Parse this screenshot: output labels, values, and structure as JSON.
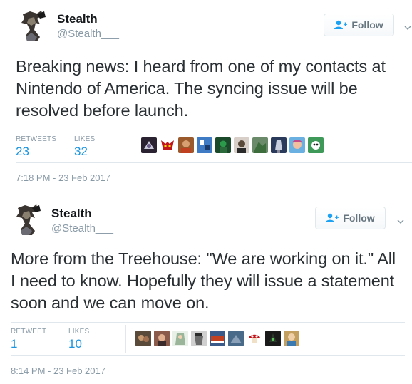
{
  "tweets": [
    {
      "name": "Stealth",
      "handle": "@Stealth___",
      "follow_label": "Follow",
      "text": "Breaking news: I heard from one of my contacts at Nintendo of America. The syncing issue will be resolved before launch.",
      "stats": {
        "retweets_label": "RETWEETS",
        "retweets": "23",
        "likes_label": "LIKES",
        "likes": "32"
      },
      "timestamp": "7:18 PM - 23 Feb 2017"
    },
    {
      "name": "Stealth",
      "handle": "@Stealth___",
      "follow_label": "Follow",
      "text": "More from the Treehouse: \"We are working on it.\" All I need to know. Hopefully they will issue a statement soon and we can move on.",
      "stats": {
        "retweets_label": "RETWEET",
        "retweets": "1",
        "likes_label": "LIKES",
        "likes": "10"
      },
      "timestamp": "8:14 PM - 23 Feb 2017"
    }
  ],
  "colors": {
    "link": "#1b95e0",
    "muted": "#8899a6",
    "border": "#e1e8ed",
    "text": "#292f33"
  },
  "icons": {
    "follow": "add-person-icon",
    "more": "chevron-down-icon"
  },
  "liker_avatars_1": [
    "#2a2230",
    "#c0151b",
    "#9a5a2c",
    "#3f7bc4",
    "#2b9a4a",
    "#5a4a3a",
    "#3d6d3d",
    "#2a3a5a",
    "#c24a8a",
    "#3f9a5a"
  ],
  "liker_avatars_2": [
    "#5a4a3a",
    "#8a5a4a",
    "#9ab59a",
    "#6a6a6a",
    "#3a5a8a",
    "#4a6a8a",
    "#c0151b",
    "#2a3a2a",
    "#c4a060"
  ]
}
